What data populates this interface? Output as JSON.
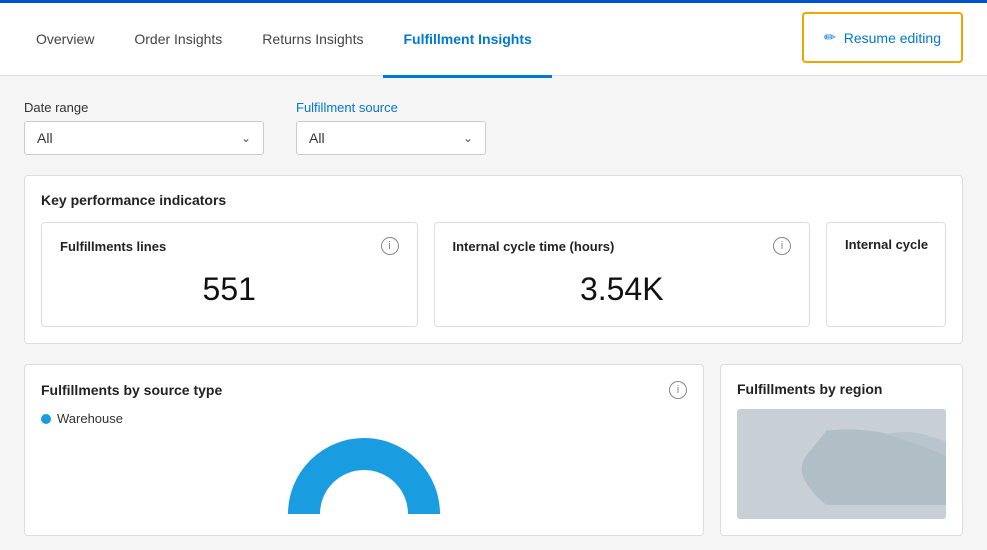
{
  "topAccent": {
    "color": "#0052cc"
  },
  "nav": {
    "items": [
      {
        "id": "overview",
        "label": "Overview",
        "active": false
      },
      {
        "id": "order-insights",
        "label": "Order Insights",
        "active": false
      },
      {
        "id": "returns-insights",
        "label": "Returns Insights",
        "active": false
      },
      {
        "id": "fulfillment-insights",
        "label": "Fulfillment Insights",
        "active": true
      }
    ],
    "resume_editing_label": "Resume editing"
  },
  "filters": {
    "date_range": {
      "label": "Date range",
      "value": "All"
    },
    "fulfillment_source": {
      "label": "Fulfillment source",
      "label_color": "blue",
      "value": "All"
    }
  },
  "kpi_section": {
    "title": "Key performance indicators",
    "cards": [
      {
        "id": "fulfillment-lines",
        "title": "Fulfillments lines",
        "value": "551"
      },
      {
        "id": "internal-cycle-time",
        "title": "Internal cycle time (hours)",
        "value": "3.54K"
      },
      {
        "id": "internal-cycle-partial",
        "title": "Internal cycle",
        "value": "",
        "partial": true
      }
    ]
  },
  "bottom_sections": {
    "fulfillments_by_source": {
      "title": "Fulfillments by source type",
      "legend": [
        {
          "label": "Warehouse",
          "color": "#1a9de0"
        }
      ]
    },
    "fulfillments_by_region": {
      "title": "Fulfillments by region"
    }
  },
  "icons": {
    "pencil": "✏",
    "chevron_down": "∨",
    "info": "i"
  }
}
